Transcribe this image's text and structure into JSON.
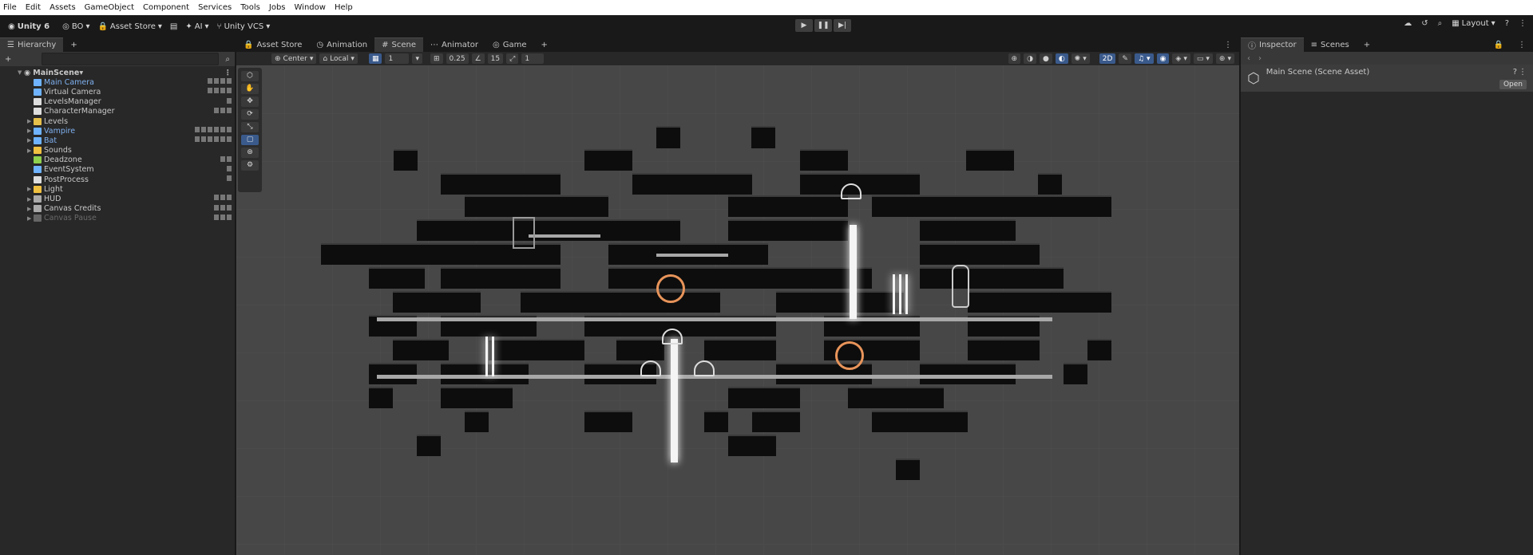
{
  "menubar": [
    "File",
    "Edit",
    "Assets",
    "GameObject",
    "Component",
    "Services",
    "Tools",
    "Jobs",
    "Window",
    "Help"
  ],
  "toolbar": {
    "unity_label": "Unity 6",
    "account": "BO",
    "asset_store": "Asset Store",
    "ai": "AI",
    "vcs": "Unity VCS",
    "layout": "Layout"
  },
  "hierarchy": {
    "tab": "Hierarchy",
    "scene": "MainScene",
    "items": [
      {
        "label": "Main Camera",
        "cls": "blue",
        "indent": 2,
        "arrow": ""
      },
      {
        "label": "Virtual Camera",
        "cls": "",
        "indent": 2,
        "arrow": ""
      },
      {
        "label": "LevelsManager",
        "cls": "",
        "indent": 2,
        "arrow": ""
      },
      {
        "label": "CharacterManager",
        "cls": "",
        "indent": 2,
        "arrow": ""
      },
      {
        "label": "Levels",
        "cls": "",
        "indent": 2,
        "arrow": "▶"
      },
      {
        "label": "Vampire",
        "cls": "blue",
        "indent": 2,
        "arrow": "▶"
      },
      {
        "label": "Bat",
        "cls": "blue",
        "indent": 2,
        "arrow": "▶"
      },
      {
        "label": "Sounds",
        "cls": "",
        "indent": 2,
        "arrow": "▶"
      },
      {
        "label": "Deadzone",
        "cls": "",
        "indent": 2,
        "arrow": ""
      },
      {
        "label": "EventSystem",
        "cls": "",
        "indent": 2,
        "arrow": ""
      },
      {
        "label": "PostProcess",
        "cls": "",
        "indent": 2,
        "arrow": ""
      },
      {
        "label": "Light",
        "cls": "",
        "indent": 2,
        "arrow": "▶"
      },
      {
        "label": "HUD",
        "cls": "",
        "indent": 2,
        "arrow": "▶"
      },
      {
        "label": "Canvas Credits",
        "cls": "",
        "indent": 2,
        "arrow": "▶"
      },
      {
        "label": "Canvas Pause",
        "cls": "dim",
        "indent": 2,
        "arrow": "▶"
      }
    ]
  },
  "scene_tabs": [
    "Asset Store",
    "Animation",
    "Scene",
    "Animator",
    "Game"
  ],
  "scene_bar": {
    "pivot": "Center",
    "space": "Local",
    "grid": "1",
    "snap": "0.25",
    "angle": "15",
    "scale": "1",
    "mode2d": "2D"
  },
  "inspector": {
    "tab1": "Inspector",
    "tab2": "Scenes",
    "title": "Main Scene (Scene Asset)",
    "open_btn": "Open"
  },
  "colors": {
    "accent": "#3a5a8c",
    "ornament": "#e8945a"
  }
}
